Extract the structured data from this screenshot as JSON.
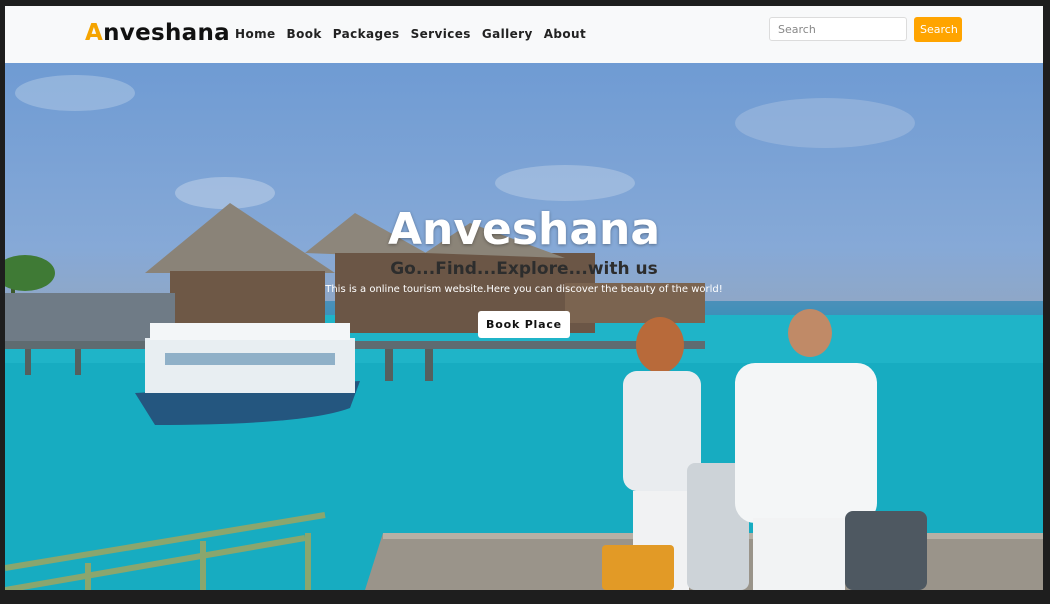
{
  "brand": {
    "first_letter": "A",
    "rest": "nveshana"
  },
  "nav": {
    "items": [
      "Home",
      "Book",
      "Packages",
      "Services",
      "Gallery",
      "About"
    ]
  },
  "search": {
    "placeholder": "Search",
    "button_label": "Search"
  },
  "hero": {
    "title": "Anveshana",
    "subtitle": "Go...Find...Explore...with us",
    "description": "This is a online tourism website.Here you can discover the beauty of the world!",
    "button_label": "Book Place"
  },
  "colors": {
    "accent": "#ffa400",
    "navbar_bg": "#f8f9fa"
  }
}
